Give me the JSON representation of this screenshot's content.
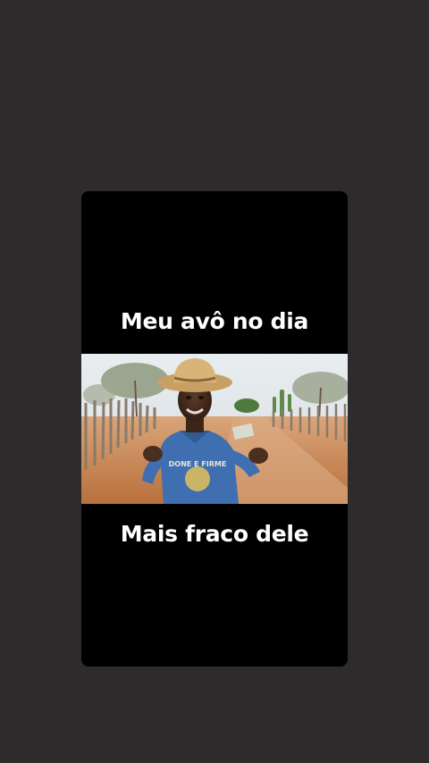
{
  "meme": {
    "top_text": "Meu avô no dia",
    "bottom_text": "Mais fraco dele",
    "shirt_text": "DONE E FIRME"
  },
  "colors": {
    "page_background": "#2d2b2b",
    "card_background": "#000000",
    "caption_color": "#ffffff",
    "sky": "#dfe6ea",
    "dirt_road": "#c98a55",
    "shirt": "#3f6fb0",
    "hat": "#c9a063"
  },
  "photo": {
    "subject": "elderly man in straw hat and blue shirt",
    "scene": "dirt road with wooden fences, trees and cactus"
  }
}
